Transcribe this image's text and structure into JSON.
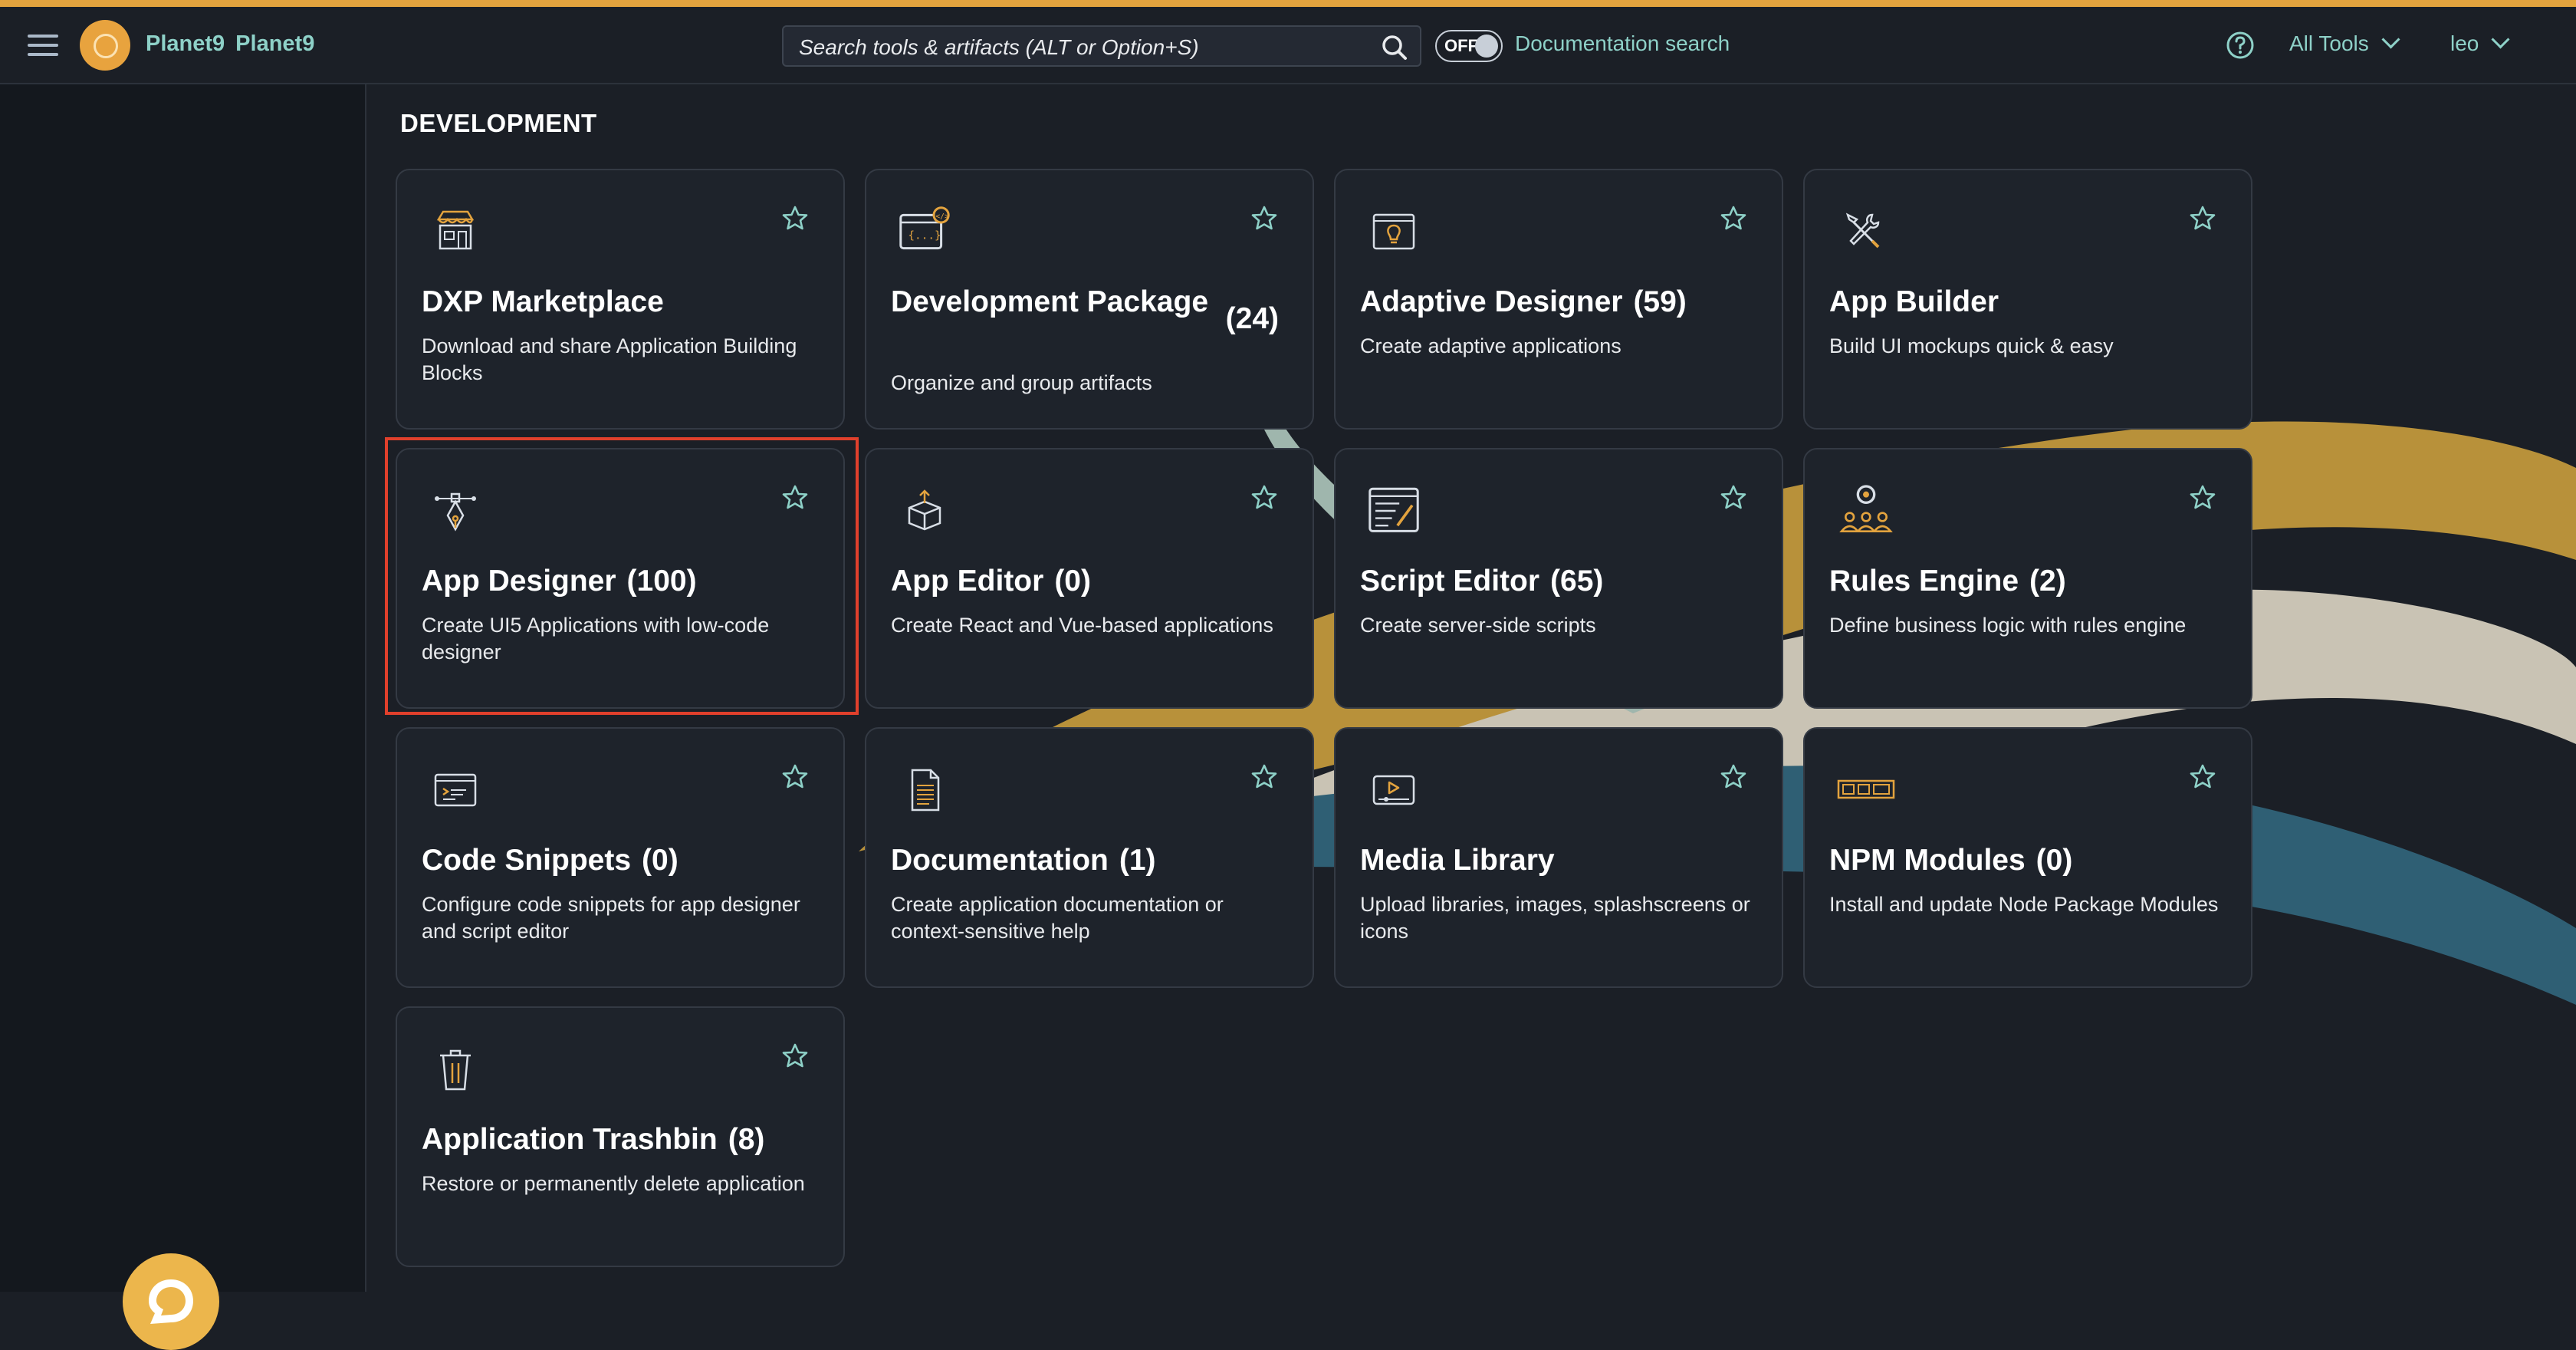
{
  "brand": {
    "name1": "Planet9",
    "name2": "Planet9"
  },
  "search": {
    "placeholder": "Search tools & artifacts (ALT or Option+S)"
  },
  "doc_toggle": {
    "state": "OFF",
    "label": "Documentation search"
  },
  "header": {
    "all_tools": "All Tools",
    "user": "leo"
  },
  "section": {
    "title": "DEVELOPMENT"
  },
  "tiles": [
    {
      "title": "DXP Marketplace",
      "count": "",
      "desc": "Download and share Application Building Blocks",
      "icon": "marketplace-icon"
    },
    {
      "title": "Development Package",
      "count": "(24)",
      "desc": "Organize and group artifacts",
      "icon": "package-icon"
    },
    {
      "title": "Adaptive Designer",
      "count": "(59)",
      "desc": "Create adaptive applications",
      "icon": "adaptive-designer-icon"
    },
    {
      "title": "App Builder",
      "count": "",
      "desc": "Build UI mockups quick & easy",
      "icon": "tools-icon"
    },
    {
      "title": "App Designer",
      "count": "(100)",
      "desc": "Create UI5 Applications with low-code designer",
      "icon": "pen-tool-icon"
    },
    {
      "title": "App Editor",
      "count": "(0)",
      "desc": "Create React and Vue-based applications",
      "icon": "box-icon"
    },
    {
      "title": "Script Editor",
      "count": "(65)",
      "desc": "Create server-side scripts",
      "icon": "script-icon"
    },
    {
      "title": "Rules Engine",
      "count": "(2)",
      "desc": "Define business logic with rules engine",
      "icon": "rules-icon"
    },
    {
      "title": "Code Snippets",
      "count": "(0)",
      "desc": "Configure code snippets for app designer and script editor",
      "icon": "code-window-icon"
    },
    {
      "title": "Documentation",
      "count": "(1)",
      "desc": "Create application documentation or context-sensitive help",
      "icon": "document-icon"
    },
    {
      "title": "Media Library",
      "count": "",
      "desc": "Upload libraries, images, splashscreens or icons",
      "icon": "media-icon"
    },
    {
      "title": "NPM Modules",
      "count": "(0)",
      "desc": "Install and update Node Package Modules",
      "icon": "npm-icon"
    },
    {
      "title": "Application Trashbin",
      "count": "(8)",
      "desc": "Restore or permanently delete application",
      "icon": "trash-icon"
    }
  ],
  "colors": {
    "accent": "#e3a33e",
    "link": "#8ed1c8",
    "background": "#1b1f26",
    "tile": "#1e232b",
    "highlight": "#e0402c"
  }
}
